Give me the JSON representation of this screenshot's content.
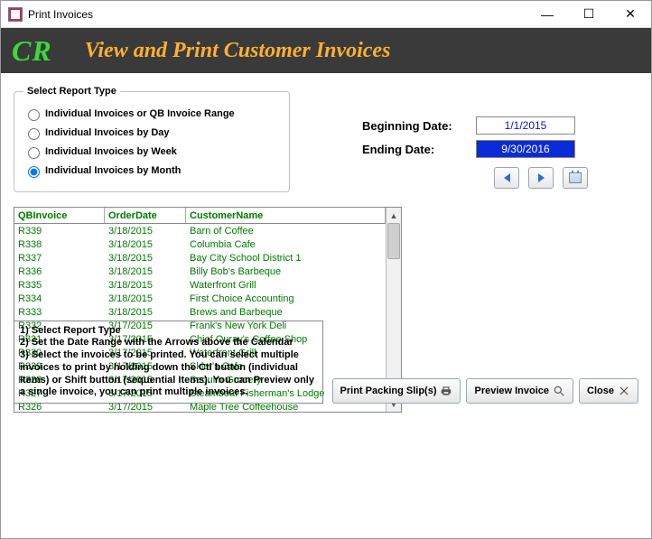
{
  "window": {
    "title": "Print Invoices",
    "minimize_glyph": "—",
    "maximize_glyph": "☐",
    "close_glyph": "✕"
  },
  "header": {
    "brand": "CR",
    "title": "View and Print Customer Invoices"
  },
  "report_type": {
    "legend": "Select Report Type",
    "options": [
      {
        "label": "Individual Invoices or QB Invoice Range",
        "checked": false
      },
      {
        "label": "Individual Invoices by Day",
        "checked": false
      },
      {
        "label": "Individual Invoices by Week",
        "checked": false
      },
      {
        "label": "Individual Invoices by Month",
        "checked": true
      }
    ]
  },
  "dates": {
    "begin_label": "Beginning Date:",
    "end_label": "Ending Date:",
    "begin_value": "1/1/2015",
    "end_value": "9/30/2016"
  },
  "grid": {
    "headers": {
      "invoice": "QBInvoice",
      "date": "OrderDate",
      "customer": "CustomerName"
    },
    "rows": [
      {
        "invoice": "R339",
        "date": "3/18/2015",
        "customer": "Barn of Coffee"
      },
      {
        "invoice": "R338",
        "date": "3/18/2015",
        "customer": "Columbia Cafe"
      },
      {
        "invoice": "R337",
        "date": "3/18/2015",
        "customer": "Bay City School District 1"
      },
      {
        "invoice": "R336",
        "date": "3/18/2015",
        "customer": "Billy Bob's Barbeque"
      },
      {
        "invoice": "R335",
        "date": "3/18/2015",
        "customer": "Waterfront Grill"
      },
      {
        "invoice": "R334",
        "date": "3/18/2015",
        "customer": "First Choice Accounting"
      },
      {
        "invoice": "R333",
        "date": "3/18/2015",
        "customer": "Brews and Barbeque"
      },
      {
        "invoice": "R332",
        "date": "3/17/2015",
        "customer": "Frank's New York Deli"
      },
      {
        "invoice": "R331",
        "date": "3/17/2015",
        "customer": "Chief Ouray's Coffee Shop"
      },
      {
        "invoice": "R330",
        "date": "3/17/2015",
        "customer": "Waterfront Grill"
      },
      {
        "invoice": "R329",
        "date": "3/17/2015",
        "customer": "Skier's Cafe"
      },
      {
        "invoice": "R328",
        "date": "3/17/2015",
        "customer": "Sequim Grocery"
      },
      {
        "invoice": "R327",
        "date": "3/17/2015",
        "customer": "Steamboat Fisherman's Lodge"
      },
      {
        "invoice": "R326",
        "date": "3/17/2015",
        "customer": "Maple Tree Coffeehouse"
      }
    ]
  },
  "instructions": {
    "line1": "1)  Select Report Type",
    "line2": "2)  Set the Date Range with the Arrows above the Calendar",
    "line3": "3)  Select the invoices to be printed.  You can select multiple invoices to print by holding down the Ctl button (individual Items) or Shift button  (sequential Items).  You can Preview only a single invoice, you can print multiple invoices."
  },
  "buttons": {
    "print_packing": "Print Packing Slip(s)",
    "preview": "Preview Invoice",
    "close": "Close"
  }
}
